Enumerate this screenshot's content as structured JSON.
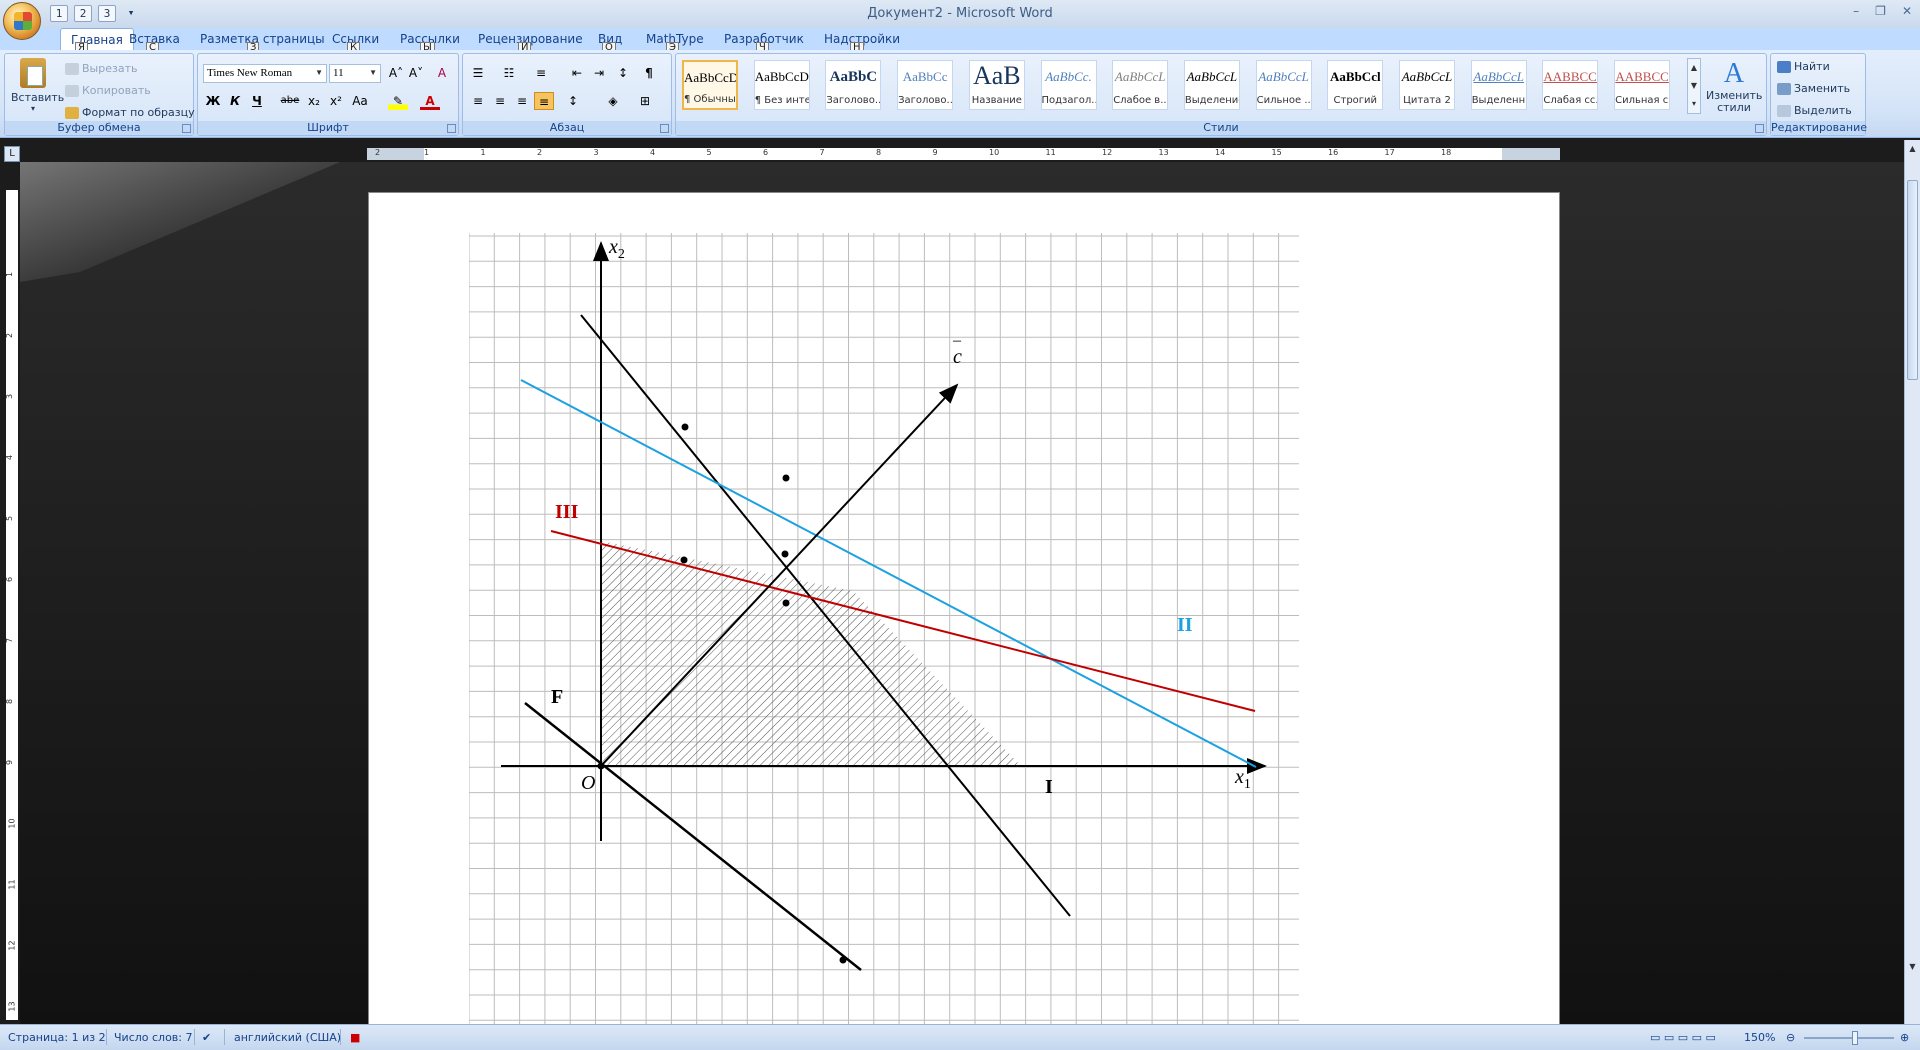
{
  "window": {
    "title": "Документ2 - Microsoft Word",
    "controls": [
      "–",
      "❐",
      "✕"
    ]
  },
  "qat": {
    "save_keytip": "1",
    "undo_keytip": "2",
    "redo_keytip": "3",
    "customize": "▾"
  },
  "tabs": [
    {
      "label": "Главная",
      "keytip": "Я"
    },
    {
      "label": "Вставка",
      "keytip": "С"
    },
    {
      "label": "Разметка страницы",
      "keytip": "З"
    },
    {
      "label": "Ссылки",
      "keytip": "К"
    },
    {
      "label": "Рассылки",
      "keytip": "Ы"
    },
    {
      "label": "Рецензирование",
      "keytip": "И"
    },
    {
      "label": "Вид",
      "keytip": "О"
    },
    {
      "label": "MathType",
      "keytip": "Э"
    },
    {
      "label": "Разработчик",
      "keytip": "Ч"
    },
    {
      "label": "Надстройки",
      "keytip": "Н"
    }
  ],
  "clipboard": {
    "paste": "Вставить",
    "cut": "Вырезать",
    "copy": "Копировать",
    "format_painter": "Формат по образцу",
    "label": "Буфер обмена"
  },
  "font": {
    "name": "Times New Roman",
    "size": "11",
    "label": "Шрифт",
    "bold": "Ж",
    "italic": "К",
    "underline": "Ч",
    "strike": "abe",
    "sub": "x₂",
    "sup": "x²",
    "case": "Aa",
    "grow": "A˄",
    "shrink": "A˅",
    "clear": "A"
  },
  "paragraph": {
    "label": "Абзац",
    "pilcrow": "¶"
  },
  "styles": {
    "label": "Стили",
    "items": [
      {
        "sample": "AaBbCcD",
        "name": "¶ Обычный",
        "color": "#000000"
      },
      {
        "sample": "AaBbCcD",
        "name": "¶ Без инте...",
        "color": "#000000"
      },
      {
        "sample": "AaBbC",
        "name": "Заголово...",
        "color": "#17365d"
      },
      {
        "sample": "AaBbCc",
        "name": "Заголово...",
        "color": "#4f81bd"
      },
      {
        "sample": "AaB",
        "name": "Название",
        "color": "#17365d"
      },
      {
        "sample": "AaBbCc.",
        "name": "Подзагол...",
        "color": "#4f81bd"
      },
      {
        "sample": "AaBbCcL",
        "name": "Слабое в...",
        "color": "#808080"
      },
      {
        "sample": "AaBbCcL",
        "name": "Выделение",
        "color": "#000000"
      },
      {
        "sample": "AaBbCcL",
        "name": "Сильное ...",
        "color": "#4f81bd"
      },
      {
        "sample": "AaBbCcl",
        "name": "Строгий",
        "color": "#000000"
      },
      {
        "sample": "AaBbCcL",
        "name": "Цитата 2",
        "color": "#000000"
      },
      {
        "sample": "AaBbCcL",
        "name": "Выделенн...",
        "color": "#4f81bd"
      },
      {
        "sample": "AABBCCI",
        "name": "Слабая сс...",
        "color": "#c0504d"
      },
      {
        "sample": "AABBCC",
        "name": "Сильная с...",
        "color": "#c0504d"
      }
    ],
    "change": "Изменить стили"
  },
  "editing": {
    "label": "Редактирование",
    "find": "Найти",
    "replace": "Заменить",
    "select": "Выделить"
  },
  "ruler": {
    "h_numbers": [
      "2",
      "1",
      "1",
      "2",
      "3",
      "4",
      "5",
      "6",
      "7",
      "8",
      "9",
      "10",
      "11",
      "12",
      "13",
      "14",
      "15",
      "16",
      "17",
      "18"
    ],
    "v_numbers": [
      "1",
      "2",
      "3",
      "4",
      "5",
      "6",
      "7",
      "8",
      "9",
      "10",
      "11",
      "12",
      "13"
    ]
  },
  "figure": {
    "labels": {
      "x2": "x",
      "x2_sub": "2",
      "x1": "x",
      "x1_sub": "1",
      "origin": "O",
      "c": "c",
      "bar": "–",
      "line1": "I",
      "line2": "II",
      "line3": "III",
      "f": "F"
    },
    "colors": {
      "line1": "#000000",
      "line2": "#1ba1e2",
      "line3": "#c00000",
      "grid": "#bdbdbd"
    }
  },
  "status": {
    "page": "Страница: 1 из 2",
    "words": "Число слов: 7",
    "lang": "английский (США)",
    "zoom": "150%"
  }
}
